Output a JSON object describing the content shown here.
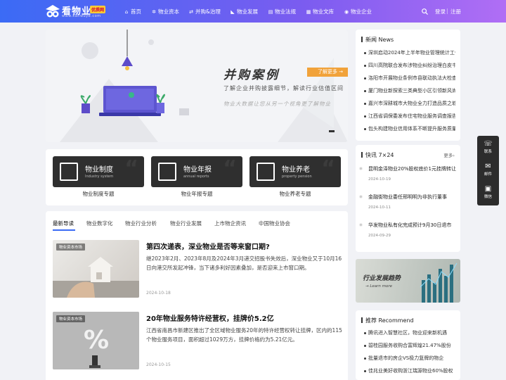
{
  "logo": {
    "title": "看物业",
    "badge": "优质网",
    "url": "www.kanwuye.com"
  },
  "nav": [
    {
      "label": "首页",
      "icon": "home-icon",
      "glyph": "⌂"
    },
    {
      "label": "物业资本",
      "icon": "capital-icon",
      "glyph": "✲"
    },
    {
      "label": "并购&治理",
      "icon": "merger-icon",
      "glyph": "⇄"
    },
    {
      "label": "物业发展",
      "icon": "growth-icon",
      "glyph": "◣"
    },
    {
      "label": "物业法规",
      "icon": "law-icon",
      "glyph": "▤"
    },
    {
      "label": "物业文库",
      "icon": "library-icon",
      "glyph": "▦"
    },
    {
      "label": "物业企业",
      "icon": "company-icon",
      "glyph": "◉"
    }
  ],
  "auth": {
    "login": "登录",
    "sep": "|",
    "register": "注册"
  },
  "banner": {
    "title": "并购案例",
    "button": "了解更多 →",
    "subtitle": "了解企业并购披露细节，解读行业估值区间",
    "subtitle2": "物业大数据让您从另一个视角更了解物业"
  },
  "categories": [
    {
      "name": "物业制度",
      "en": "Industry system",
      "label": "物业制度专题"
    },
    {
      "name": "物业年报",
      "en": "annual reports",
      "label": "物业年报专题"
    },
    {
      "name": "物业养老",
      "en": "property pension",
      "label": "物业养老专题"
    }
  ],
  "tabs": [
    "最新导读",
    "物业数字化",
    "物业行业分析",
    "物业行业发展",
    "上市物企资讯",
    "中国物业协会"
  ],
  "articles": [
    {
      "tag": "物业资本市场",
      "title": "第四次递表，深业物业是否等来窗口期?",
      "desc": "继2023年2月、2023年8月及2024年3月递交招股书失效后，深业物业又于10月16日向港交所发起冲锋，当下诸多利好因素叠加，是否迎来上市窗口期。",
      "date": "2024-10-18"
    },
    {
      "tag": "物业资本市场",
      "title": "20年物业服务特许经营权，挂牌价5.2亿",
      "desc": "江西省南昌市新建区推出了全区域物业服务20年的特许经营权转让挂牌，区内的115个物业服务项目，面积超过1029万方，挂牌价格约为5.21亿元。",
      "date": "2024-10-15"
    }
  ],
  "side_news": {
    "title": "新闻 News",
    "items": [
      "深圳启动2024年上半年物业管理统计工作",
      "四川高院联合发布涉物业纠纷治理白皮书",
      "洛阳市开展物业条例市县联动执法大检查",
      "厦门物业新探索三类典型小区引领新风尚",
      "嘉兴市深耕城市大物业全力打造品质之城",
      "江西省调保委发布住宅物业服务调查报告",
      "包头构建物业信用体系不断提升服务质量"
    ]
  },
  "flash": {
    "title": "快讯 7×24",
    "more": "更多›",
    "items": [
      {
        "title": "昆明金泽物业20%股权底价1元挂牌转让",
        "date": "2024-10-19"
      },
      {
        "title": "金融街物业委任邢明明为非执行董事",
        "date": "2024-10-11"
      },
      {
        "title": "华发物业私有化完成预计9月30日退市",
        "date": "2024-09-29"
      }
    ]
  },
  "promo": {
    "title": "行业发展趋势",
    "link": "→ Learn more"
  },
  "recommend": {
    "title": "推荐 Recommend",
    "items": [
      "腾讯进入智慧社区，物业迎来新机遇",
      "碧桂园服务收购合富辉煌21.47%股份",
      "批量退市的房企VS极力复牌的物企",
      "佳兆业美好收购浙江瑞源物业60%股权"
    ]
  },
  "float": [
    {
      "label": "联系",
      "glyph": "☏",
      "icon": "chat-icon"
    },
    {
      "label": "邮件",
      "glyph": "✉",
      "icon": "mail-icon"
    },
    {
      "label": "微信",
      "glyph": "▣",
      "icon": "qrcode-icon"
    }
  ],
  "colors": {
    "nav_start": "#3b6bf5",
    "nav_end": "#b06ef5",
    "accent": "#f1a23a",
    "dark_card": "#2f2f2f"
  }
}
